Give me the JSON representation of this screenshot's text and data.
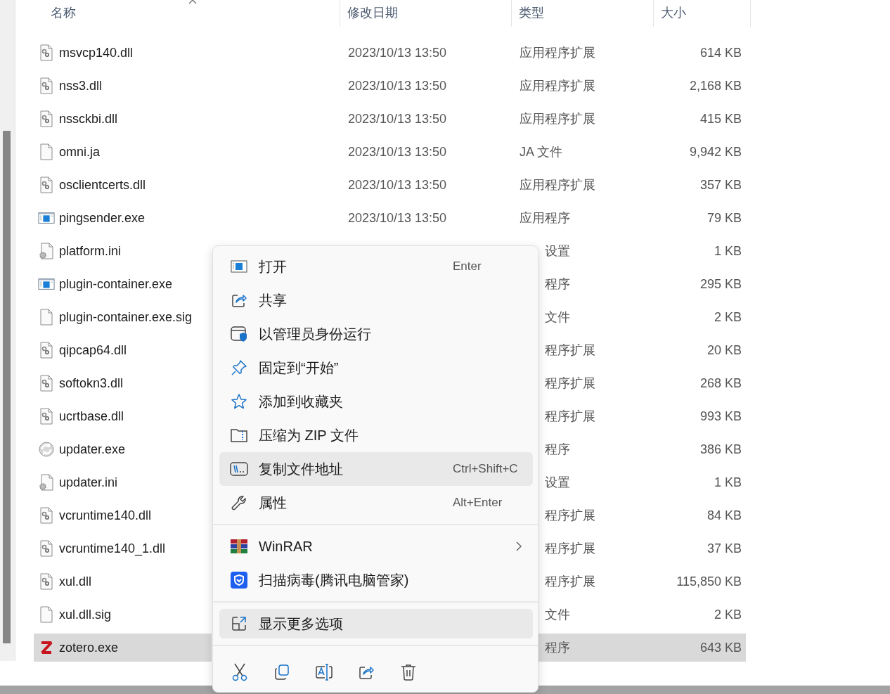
{
  "columns": [
    {
      "label": "名称"
    },
    {
      "label": "修改日期"
    },
    {
      "label": "类型"
    },
    {
      "label": "大小"
    }
  ],
  "rows": [
    {
      "kind": "library",
      "name": "msvcp140.dll",
      "date": "2023/10/13 13:50",
      "type": "应用程序扩展",
      "size": "614 KB",
      "selected": false
    },
    {
      "kind": "library",
      "name": "nss3.dll",
      "date": "2023/10/13 13:50",
      "type": "应用程序扩展",
      "size": "2,168 KB",
      "selected": false
    },
    {
      "kind": "library",
      "name": "nssckbi.dll",
      "date": "2023/10/13 13:50",
      "type": "应用程序扩展",
      "size": "415 KB",
      "selected": false
    },
    {
      "kind": "document",
      "name": "omni.ja",
      "date": "2023/10/13 13:50",
      "type": "JA 文件",
      "size": "9,942 KB",
      "selected": false
    },
    {
      "kind": "library",
      "name": "osclientcerts.dll",
      "date": "2023/10/13 13:50",
      "type": "应用程序扩展",
      "size": "357 KB",
      "selected": false
    },
    {
      "kind": "program",
      "name": "pingsender.exe",
      "date": "2023/10/13 13:50",
      "type": "应用程序",
      "size": "79 KB",
      "selected": false
    },
    {
      "kind": "settings",
      "name": "platform.ini",
      "type": "设置",
      "size": "1 KB",
      "selected": false
    },
    {
      "kind": "program",
      "name": "plugin-container.exe",
      "type": "程序",
      "size": "295 KB",
      "selected": false
    },
    {
      "kind": "document",
      "name": "plugin-container.exe.sig",
      "type": "文件",
      "size": "2 KB",
      "selected": false
    },
    {
      "kind": "library",
      "name": "qipcap64.dll",
      "type": "程序扩展",
      "size": "20 KB",
      "selected": false
    },
    {
      "kind": "library",
      "name": "softokn3.dll",
      "type": "程序扩展",
      "size": "268 KB",
      "selected": false
    },
    {
      "kind": "library",
      "name": "ucrtbase.dll",
      "type": "程序扩展",
      "size": "993 KB",
      "selected": false
    },
    {
      "kind": "updater",
      "name": "updater.exe",
      "type": "程序",
      "size": "386 KB",
      "selected": false
    },
    {
      "kind": "settings",
      "name": "updater.ini",
      "type": "设置",
      "size": "1 KB",
      "selected": false
    },
    {
      "kind": "library",
      "name": "vcruntime140.dll",
      "type": "程序扩展",
      "size": "84 KB",
      "selected": false
    },
    {
      "kind": "library",
      "name": "vcruntime140_1.dll",
      "type": "程序扩展",
      "size": "37 KB",
      "selected": false
    },
    {
      "kind": "library",
      "name": "xul.dll",
      "type": "程序扩展",
      "size": "115,850 KB",
      "selected": false
    },
    {
      "kind": "document",
      "name": "xul.dll.sig",
      "type": "文件",
      "size": "2 KB",
      "selected": false
    },
    {
      "kind": "zotero",
      "name": "zotero.exe",
      "type": "程序",
      "size": "643 KB",
      "selected": true
    }
  ],
  "context_menu": {
    "sections": [
      [
        {
          "kind": "open",
          "label": "打开",
          "shortcut": "Enter",
          "selected": false
        },
        {
          "kind": "share",
          "label": "共享",
          "selected": false
        },
        {
          "kind": "admin",
          "label": "以管理员身份运行",
          "selected": false
        },
        {
          "kind": "pin",
          "label": "固定到“开始”",
          "selected": false
        },
        {
          "kind": "star",
          "label": "添加到收藏夹",
          "selected": false
        },
        {
          "kind": "zip",
          "label": "压缩为 ZIP 文件",
          "selected": false
        },
        {
          "kind": "path",
          "label": "复制文件地址",
          "shortcut": "Ctrl+Shift+C",
          "selected": true
        },
        {
          "kind": "wrench",
          "label": "属性",
          "shortcut": "Alt+Enter",
          "selected": false
        }
      ],
      [
        {
          "kind": "archive",
          "label": "WinRAR",
          "submenu": true,
          "selected": false
        },
        {
          "kind": "guard",
          "label": "扫描病毒(腾讯电脑管家)",
          "selected": false
        }
      ],
      [
        {
          "kind": "more",
          "label": "显示更多选项",
          "selected": true
        }
      ]
    ],
    "actions": [
      {
        "kind": "cut"
      },
      {
        "kind": "copy"
      },
      {
        "kind": "rename"
      },
      {
        "kind": "share"
      },
      {
        "kind": "delete"
      }
    ]
  }
}
